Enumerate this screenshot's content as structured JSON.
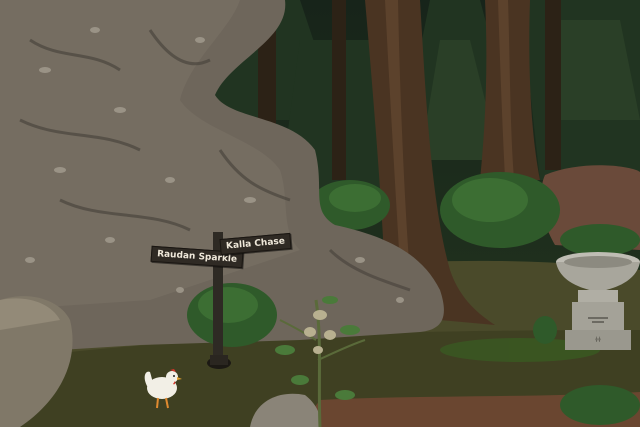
{
  "signpost": {
    "left_sign": "Raudan Sparkle",
    "right_sign": "Kalla Chase"
  },
  "scene": {
    "items": [
      "boulder-cliff",
      "signpost",
      "chicken",
      "pedestal-basin",
      "plant",
      "forest-trees"
    ]
  }
}
